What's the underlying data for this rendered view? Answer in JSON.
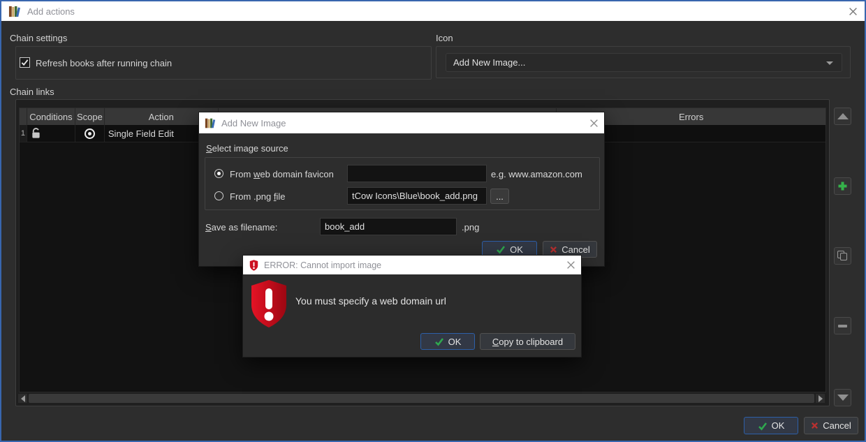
{
  "window": {
    "title": "Add actions"
  },
  "chain_settings": {
    "label": "Chain settings",
    "checkbox_label": "Refresh books after running chain",
    "checkbox_checked": true
  },
  "icon_section": {
    "label": "Icon",
    "dropdown_value": "Add New Image..."
  },
  "chain_links": {
    "label": "Chain links",
    "columns": {
      "conditions": "Conditions",
      "scope": "Scope",
      "action": "Action",
      "errors": "Errors"
    },
    "rows": [
      {
        "num": "1",
        "action": "Single Field Edit"
      }
    ]
  },
  "footer": {
    "ok_label": "OK",
    "cancel_label": "Cancel"
  },
  "add_image_dialog": {
    "title": "Add New Image",
    "select_label": {
      "pre": "",
      "key": "S",
      "rest": "elect image source"
    },
    "radio_favicon": {
      "pre": "From ",
      "key": "w",
      "rest": "eb domain favicon"
    },
    "favicon_value": "",
    "favicon_hint": "e.g. www.amazon.com",
    "radio_png": {
      "pre": "From .png ",
      "key": "f",
      "rest": "ile"
    },
    "png_path_value": "tCow Icons\\Blue\\book_add.png",
    "browse_label": "...",
    "save_label": {
      "pre": "",
      "key": "S",
      "rest": "ave as filename:"
    },
    "filename_value": "book_add",
    "extension_label": ".png",
    "ok_label": "OK",
    "cancel_label": "Cancel"
  },
  "error_dialog": {
    "title": "ERROR: Cannot import image",
    "message": "You must specify a web domain url",
    "ok_label": "OK",
    "copy_label": {
      "pre": "",
      "key": "C",
      "rest": "opy to clipboard"
    }
  },
  "colors": {
    "accent_blue": "#2d5fa8",
    "error_red": "#cc1020",
    "check_green": "#2fa84f",
    "add_green": "#35b24a"
  }
}
